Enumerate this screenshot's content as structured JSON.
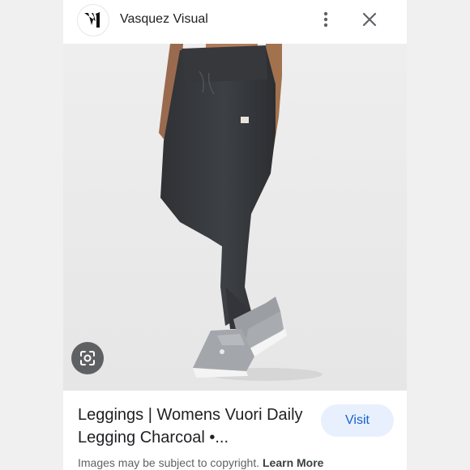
{
  "header": {
    "site_name": "Vasquez Visual",
    "logo_text": "V1",
    "more_icon": "more-vert-icon",
    "close_icon": "close-icon"
  },
  "image": {
    "subject": "women wearing charcoal leggings and grey slip-on sneakers",
    "lens_icon": "lens-search-icon"
  },
  "result": {
    "title": "Leggings | Womens Vuori Daily Legging Charcoal •...",
    "visit_label": "Visit"
  },
  "footer": {
    "copyright_text": "Images may be subject to copyright.",
    "learn_more_label": "Learn More"
  },
  "colors": {
    "accent": "#1a5fd0",
    "visit_bg": "#e8f0fe",
    "legging": "#3a3c40"
  }
}
